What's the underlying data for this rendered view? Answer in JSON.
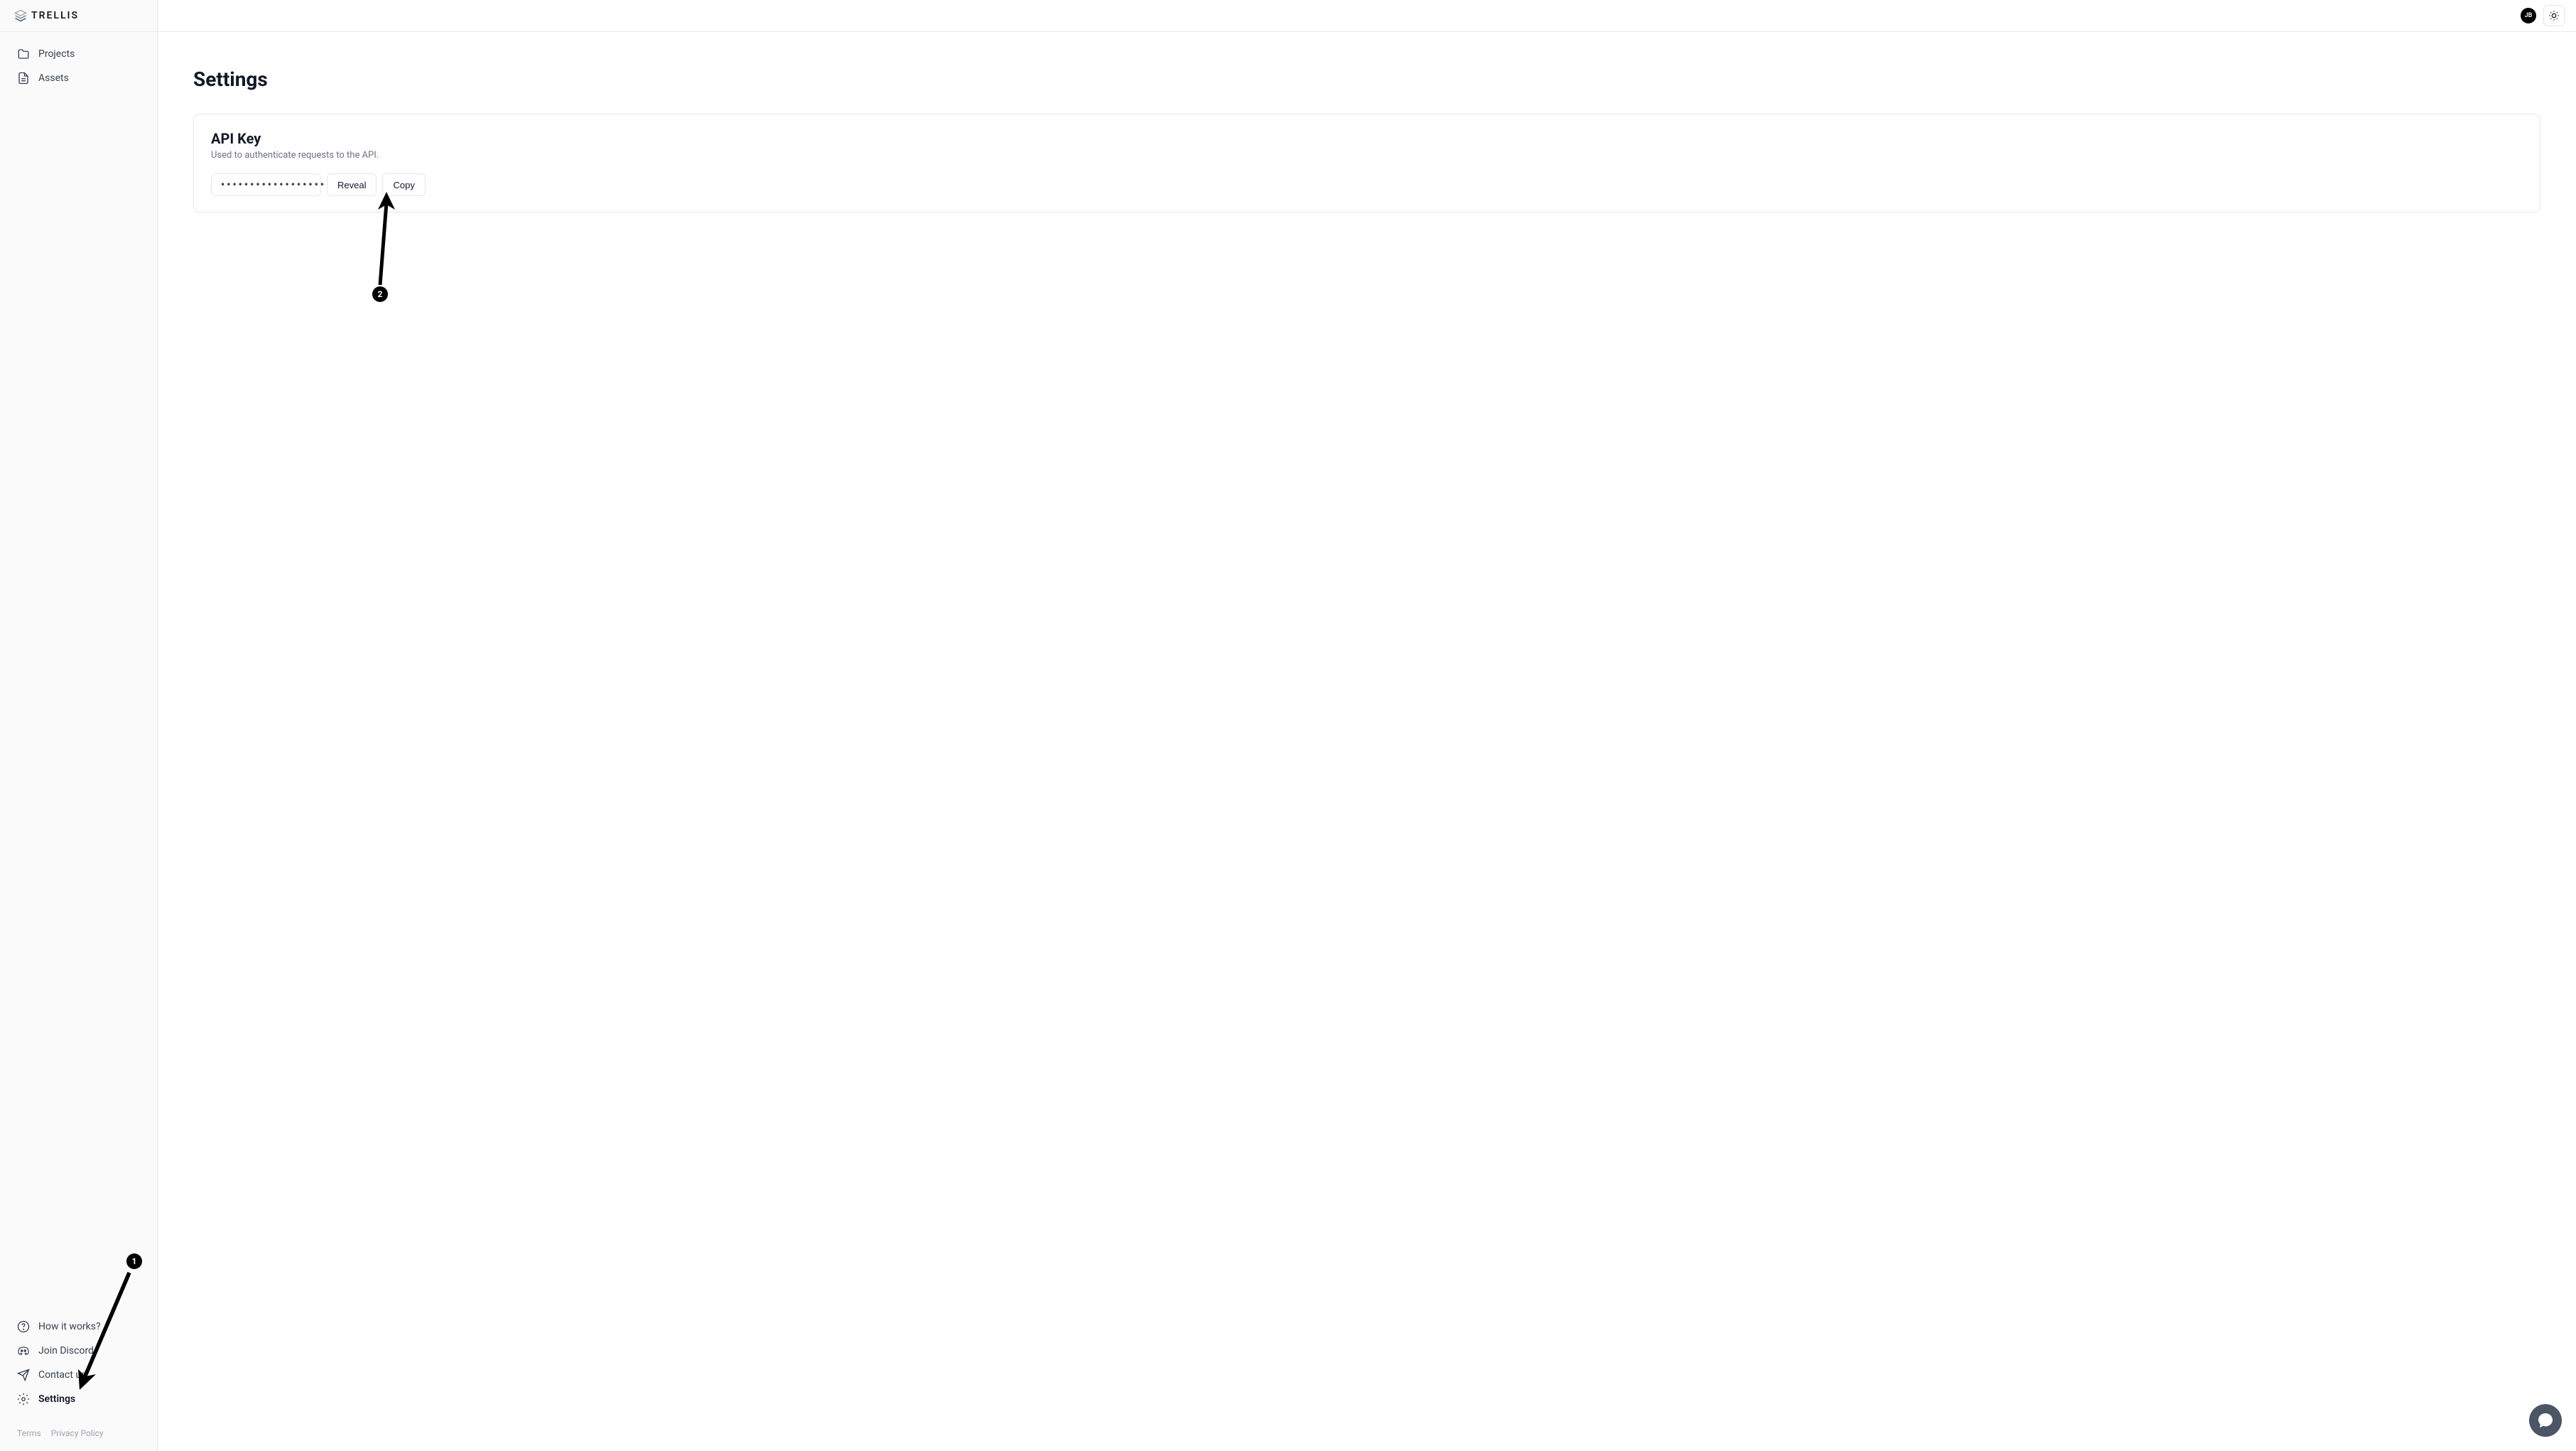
{
  "brand": {
    "name": "TRELLIS"
  },
  "sidebar": {
    "items": [
      {
        "label": "Projects"
      },
      {
        "label": "Assets"
      }
    ],
    "bottomItems": [
      {
        "label": "How it works?"
      },
      {
        "label": "Join Discord"
      },
      {
        "label": "Contact us"
      },
      {
        "label": "Settings"
      }
    ]
  },
  "footer": {
    "terms": "Terms",
    "privacy": "Privacy Policy"
  },
  "topbar": {
    "avatarInitials": "JB"
  },
  "page": {
    "title": "Settings"
  },
  "apiKey": {
    "title": "API Key",
    "description": "Used to authenticate requests to the API.",
    "maskedValue": "••••••••••••••••••••",
    "revealLabel": "Reveal",
    "copyLabel": "Copy"
  },
  "annotations": {
    "one": "1",
    "two": "2"
  }
}
